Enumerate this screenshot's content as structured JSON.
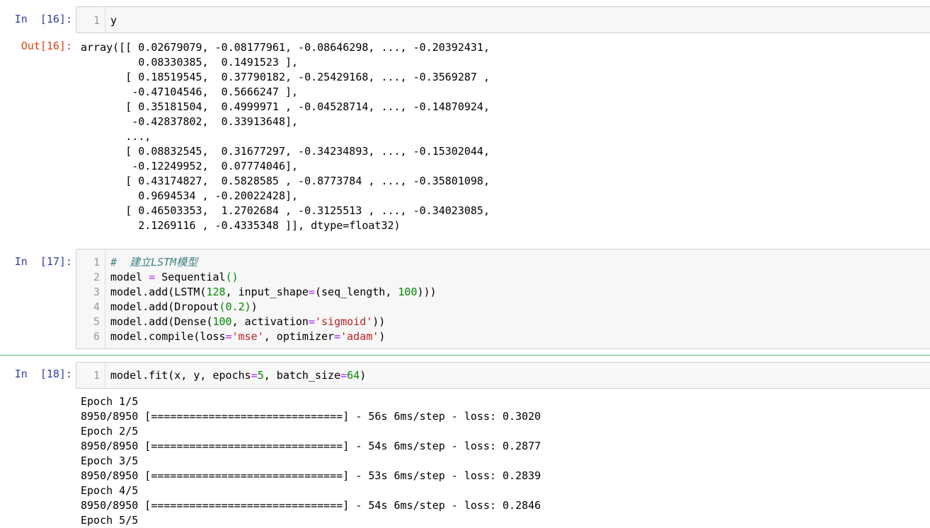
{
  "cells": [
    {
      "in_prompt": "In  [16]:",
      "code_lines": [
        "y"
      ],
      "line_numbers": [
        "1"
      ],
      "out_prompt": "Out[16]:",
      "output_lines": [
        "array([[ 0.02679079, -0.08177961, -0.08646298, ..., -0.20392431,",
        "         0.08330385,  0.1491523 ],",
        "       [ 0.18519545,  0.37790182, -0.25429168, ..., -0.3569287 ,",
        "        -0.47104546,  0.5666247 ],",
        "       [ 0.35181504,  0.4999971 , -0.04528714, ..., -0.14870924,",
        "        -0.42837802,  0.33913648],",
        "       ...,",
        "       [ 0.08832545,  0.31677297, -0.34234893, ..., -0.15302044,",
        "        -0.12249952,  0.07774046],",
        "       [ 0.43174827,  0.5828585 , -0.8773784 , ..., -0.35801098,",
        "         0.9694534 , -0.20022428],",
        "       [ 0.46503353,  1.2702684 , -0.3125513 , ..., -0.34023085,",
        "         2.1269116 , -0.4335348 ]], dtype=float32)"
      ]
    },
    {
      "in_prompt": "In  [17]:",
      "line_numbers": [
        "1",
        "2",
        "3",
        "4",
        "5",
        "6"
      ],
      "code": {
        "l1_comment": "#  建立LSTM模型",
        "l2_a": "model ",
        "l2_op": "=",
        "l2_b": " Sequential",
        "l2_c": "()",
        "l3_a": "model.add(LSTM(",
        "l3_n1": "128",
        "l3_b": ", input_shape",
        "l3_op": "=",
        "l3_c": "(seq_length, ",
        "l3_n2": "100",
        "l3_d": ")))",
        "l4_a": "model.add(Dropout",
        "l4_p1": "(",
        "l4_n": "0.2",
        "l4_p2": ")",
        "l4_b": ")",
        "l5_a": "model.add(Dense(",
        "l5_n": "100",
        "l5_b": ", activation",
        "l5_op": "=",
        "l5_s": "'sigmoid'",
        "l5_c": "))",
        "l6_a": "model.compile(loss",
        "l6_op1": "=",
        "l6_s1": "'mse'",
        "l6_b": ", optimizer",
        "l6_op2": "=",
        "l6_s2": "'adam'",
        "l6_c": ")"
      }
    },
    {
      "in_prompt": "In  [18]:",
      "line_numbers": [
        "1"
      ],
      "code": {
        "a": "model.fit(x, y, epochs",
        "op1": "=",
        "n1": "5",
        "b": ", batch_size",
        "op2": "=",
        "n2": "64",
        "c": ")"
      },
      "output_lines": [
        "Epoch 1/5",
        "8950/8950 [==============================] - 56s 6ms/step - loss: 0.3020",
        "Epoch 2/5",
        "8950/8950 [==============================] - 54s 6ms/step - loss: 0.2877",
        "Epoch 3/5",
        "8950/8950 [==============================] - 53s 6ms/step - loss: 0.2839",
        "Epoch 4/5",
        "8950/8950 [==============================] - 54s 6ms/step - loss: 0.2846",
        "Epoch 5/5"
      ]
    }
  ]
}
